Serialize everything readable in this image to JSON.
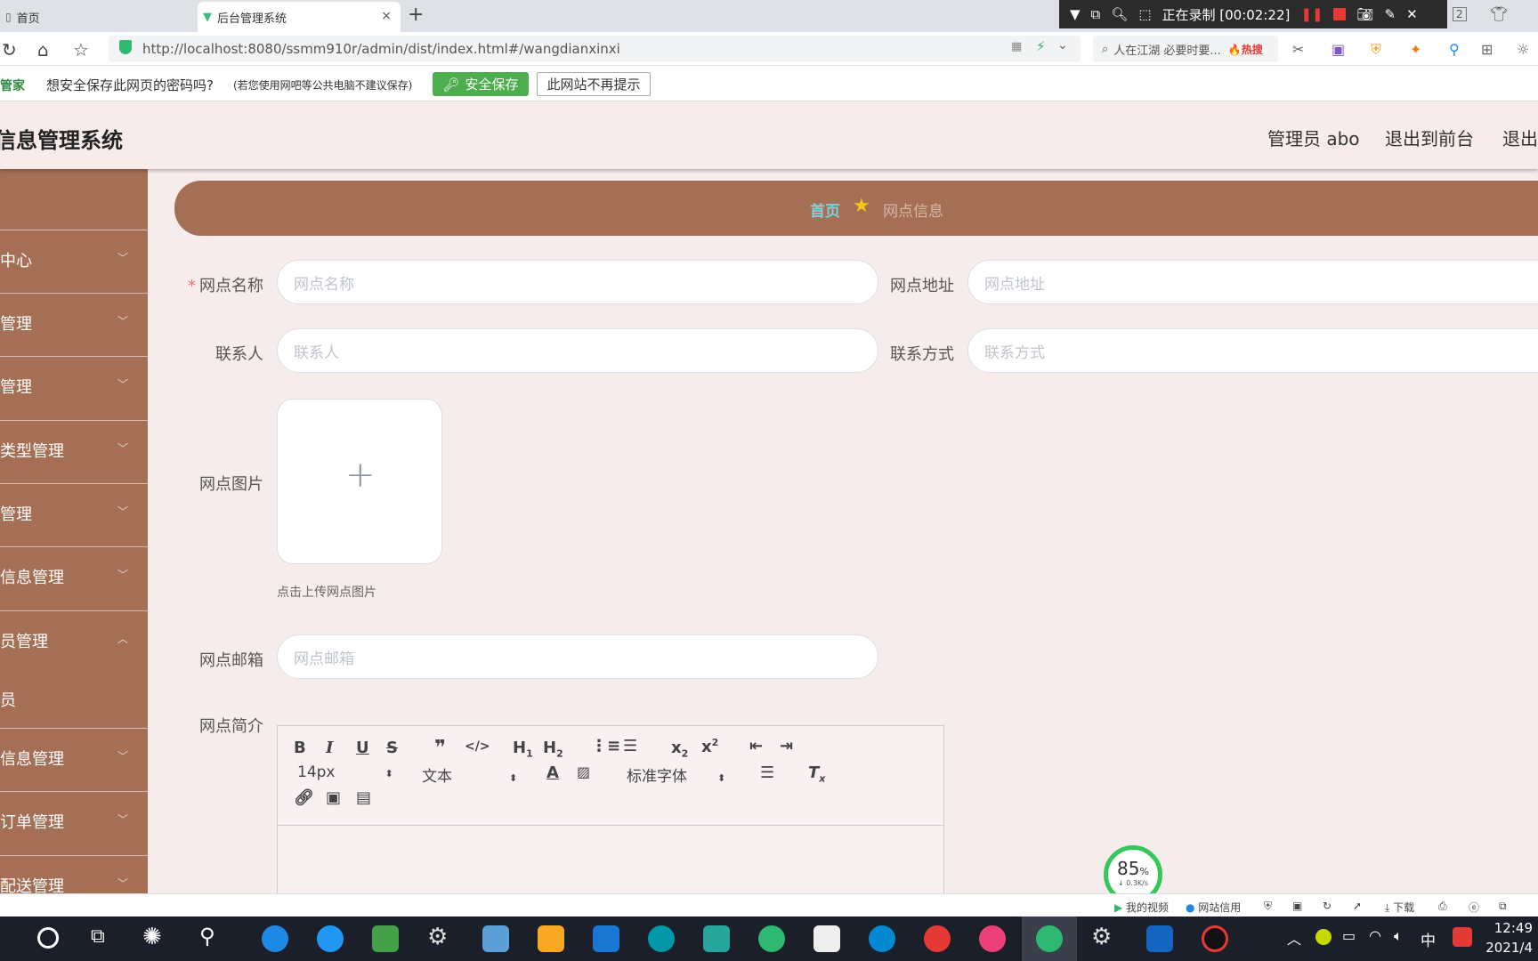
{
  "browser": {
    "tabs": [
      {
        "label": "首页",
        "active": false
      },
      {
        "label": "后台管理系统",
        "active": true
      }
    ],
    "new_tab": "+",
    "close_tab": "×",
    "url": "http://localhost:8080/ssmm910r/admin/dist/index.html#/wangdianxinxi",
    "search_placeholder": "人在江湖 必要时要...",
    "search_hot": "🔥热搜"
  },
  "recording": {
    "label": "正在录制 [00:02:22]"
  },
  "password_bar": {
    "brand": "管家",
    "question": "想安全保存此网页的密码吗?",
    "note": "(若您使用网吧等公共电脑不建议保存)",
    "save_button": "安全保存",
    "never_button": "此网站不再提示"
  },
  "header": {
    "title": "信息管理系统",
    "user": "管理员 abo",
    "to_front": "退出到前台",
    "logout": "退出"
  },
  "sidebar": {
    "items": [
      {
        "label": "中心"
      },
      {
        "label": "管理"
      },
      {
        "label": "管理"
      },
      {
        "label": "类型管理"
      },
      {
        "label": "管理"
      },
      {
        "label": "信息管理"
      },
      {
        "label": "员管理"
      },
      {
        "label": "员"
      },
      {
        "label": "信息管理"
      },
      {
        "label": "订单管理"
      },
      {
        "label": "配送管理"
      }
    ],
    "chevron_down": "﹀",
    "chevron_up": "︿"
  },
  "breadcrumb": {
    "home": "首页",
    "current": "网点信息"
  },
  "form": {
    "name_label": "网点名称",
    "name_placeholder": "网点名称",
    "address_label": "网点地址",
    "address_placeholder": "网点地址",
    "contact_label": "联系人",
    "contact_placeholder": "联系人",
    "phone_label": "联系方式",
    "phone_placeholder": "联系方式",
    "image_label": "网点图片",
    "upload_tip": "点击上传网点图片",
    "email_label": "网点邮箱",
    "email_placeholder": "网点邮箱",
    "intro_label": "网点简介",
    "required_mark": "*"
  },
  "editor": {
    "font_size": "14px",
    "header_type": "文本",
    "font_family": "标准字体"
  },
  "net_widget": {
    "percent": "85",
    "percent_unit": "%",
    "speed": "↓ 0.3K/s"
  },
  "statusbar": {
    "my_video": "我的视频",
    "site_credit": "网站信用",
    "download": "下载"
  },
  "taskbar": {
    "ime": "中",
    "time": "12:49",
    "date": "2021/4"
  }
}
